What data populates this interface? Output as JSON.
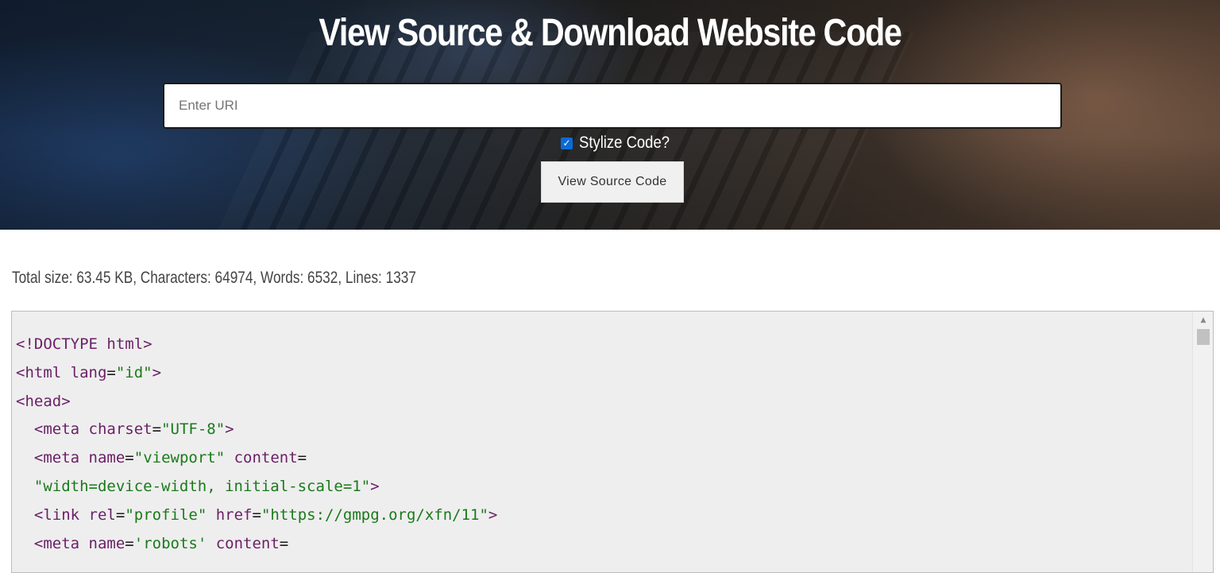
{
  "header": {
    "title": "View Source & Download Website Code"
  },
  "form": {
    "uri_placeholder": "Enter URI",
    "uri_value": "",
    "stylize_label": "Stylize Code?",
    "stylize_checked": true,
    "submit_label": "View Source Code"
  },
  "stats": {
    "text": "Total size: 63.45 KB, Characters: 64974, Words: 6532, Lines: 1337"
  },
  "colors": {
    "checkbox_accent": "#0b6bd6",
    "tag": "#6b1f66",
    "attr_value": "#1a7a1a",
    "code_bg": "#eeeeee"
  },
  "code": {
    "lines": [
      [
        {
          "k": "doc",
          "t": "<!DOCTYPE html>"
        }
      ],
      [
        {
          "k": "tag",
          "t": "<html "
        },
        {
          "k": "attr",
          "t": "lang"
        },
        {
          "k": "punct",
          "t": "="
        },
        {
          "k": "val",
          "t": "\"id\""
        },
        {
          "k": "tag",
          "t": ">"
        }
      ],
      [
        {
          "k": "tag",
          "t": "<head>"
        }
      ],
      [
        {
          "k": "punct",
          "t": "  "
        },
        {
          "k": "tag",
          "t": "<meta "
        },
        {
          "k": "attr",
          "t": "charset"
        },
        {
          "k": "punct",
          "t": "="
        },
        {
          "k": "val",
          "t": "\"UTF-8\""
        },
        {
          "k": "tag",
          "t": ">"
        }
      ],
      [
        {
          "k": "punct",
          "t": "  "
        },
        {
          "k": "tag",
          "t": "<meta "
        },
        {
          "k": "attr",
          "t": "name"
        },
        {
          "k": "punct",
          "t": "="
        },
        {
          "k": "val",
          "t": "\"viewport\""
        },
        {
          "k": "punct",
          "t": " "
        },
        {
          "k": "attr",
          "t": "content"
        },
        {
          "k": "punct",
          "t": "="
        }
      ],
      [
        {
          "k": "punct",
          "t": "  "
        },
        {
          "k": "val",
          "t": "\"width=device-width, initial-scale=1\""
        },
        {
          "k": "tag",
          "t": ">"
        }
      ],
      [
        {
          "k": "punct",
          "t": "  "
        },
        {
          "k": "tag",
          "t": "<link "
        },
        {
          "k": "attr",
          "t": "rel"
        },
        {
          "k": "punct",
          "t": "="
        },
        {
          "k": "val",
          "t": "\"profile\""
        },
        {
          "k": "punct",
          "t": " "
        },
        {
          "k": "attr",
          "t": "href"
        },
        {
          "k": "punct",
          "t": "="
        },
        {
          "k": "val",
          "t": "\"https://gmpg.org/xfn/11\""
        },
        {
          "k": "tag",
          "t": ">"
        }
      ],
      [
        {
          "k": "punct",
          "t": "  "
        },
        {
          "k": "tag",
          "t": "<meta "
        },
        {
          "k": "attr",
          "t": "name"
        },
        {
          "k": "punct",
          "t": "="
        },
        {
          "k": "val",
          "t": "'robots'"
        },
        {
          "k": "punct",
          "t": " "
        },
        {
          "k": "attr",
          "t": "content"
        },
        {
          "k": "punct",
          "t": "="
        }
      ]
    ]
  }
}
